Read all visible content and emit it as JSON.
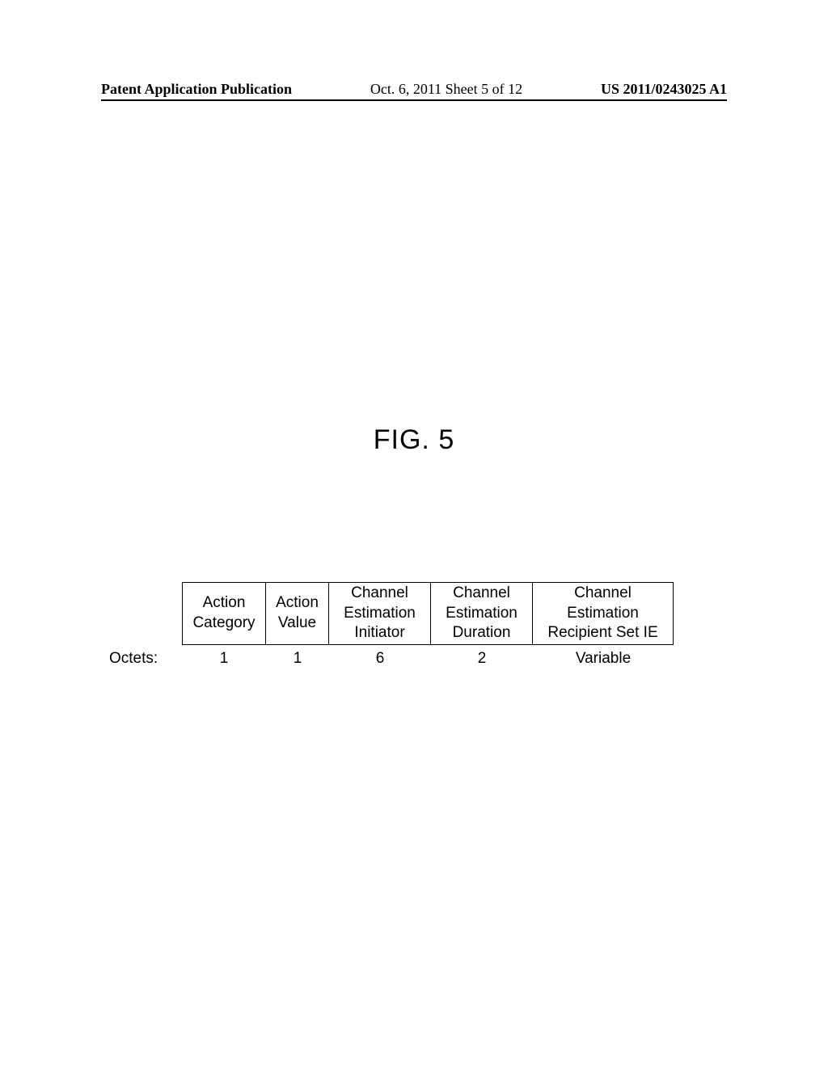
{
  "header": {
    "left": "Patent Application Publication",
    "center": "Oct. 6, 2011   Sheet 5 of 12",
    "right": "US 2011/0243025 A1"
  },
  "figure": {
    "title": "FIG. 5"
  },
  "table": {
    "fields": {
      "c1": "Action Category",
      "c2": "Action Value",
      "c3": "Channel Estimation Initiator",
      "c4": "Channel Estimation Duration",
      "c5": "Channel Estimation Recipient Set IE"
    },
    "octets_label": "Octets:",
    "octets": {
      "o1": "1",
      "o2": "1",
      "o3": "6",
      "o4": "2",
      "o5": "Variable"
    }
  }
}
